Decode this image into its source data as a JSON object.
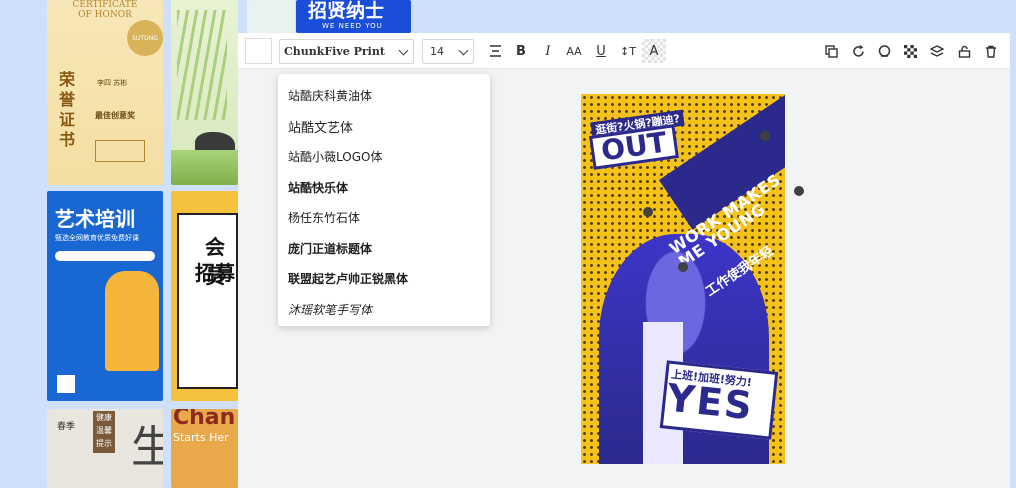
{
  "toolbar": {
    "font_name": "ChunkFive Print",
    "font_size": "14",
    "icons": [
      "align-icon",
      "bold-icon",
      "italic-icon",
      "letter-spacing-icon",
      "underline-icon",
      "line-height-icon",
      "text-background-icon",
      "copy-icon",
      "redo-icon",
      "mask-icon",
      "mosaic-icon",
      "layers-icon",
      "lock-icon",
      "delete-icon"
    ]
  },
  "font_list": [
    "站酷庆科黄油体",
    "站酷文艺体",
    "站酷小薇LOGO体",
    "站酷快乐体",
    "杨任东竹石体",
    "庞门正道标题体",
    "联盟起艺卢帅正锐黑体",
    "沐瑶软笔手写体"
  ],
  "templates": {
    "honor": {
      "line1": "CERTIFICATE",
      "line2": "OF HONOR",
      "badge": "SUTONG",
      "title": "荣誉证书",
      "name": "李四 苏彬",
      "award": "最佳创意奖"
    },
    "recruit_top": {
      "title": "招贤纳士",
      "sub": "WE NEED YOU"
    },
    "art": {
      "title": "艺术培训",
      "sub": "甄选全网教育优质免费好课"
    },
    "recruit": {
      "title": "会员",
      "title2": "招募"
    },
    "health": {
      "line1": "健康",
      "line2": "温馨",
      "line3": "提示",
      "season": "春季",
      "big": "生"
    },
    "change": {
      "text": "Chan",
      "sub": "Starts Her"
    }
  },
  "poster": {
    "out_top": "逛街?火锅?蹦迪?",
    "out": "OUT",
    "work": "WORK MAKES ME YOUNG",
    "cn1": "工作使我年轻",
    "yes_top": "上班!加班!努力!",
    "yes": "YES"
  },
  "colors": {
    "poster_yellow": "#f5c21b",
    "poster_blue": "#2b2a8c"
  }
}
